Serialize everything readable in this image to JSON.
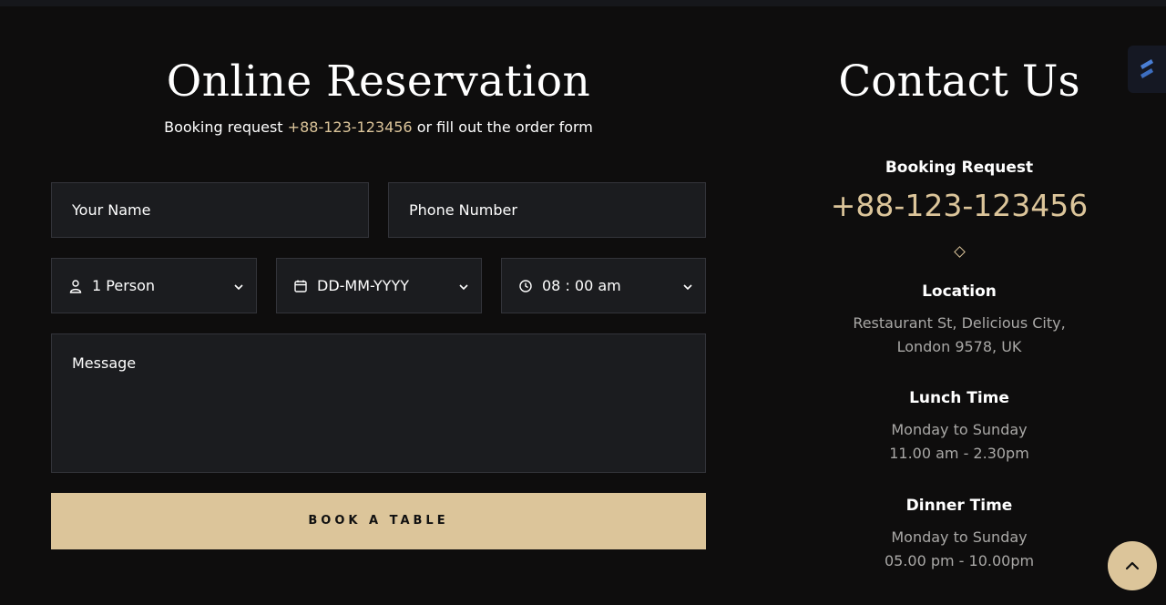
{
  "reservation": {
    "title": "Online Reservation",
    "subtitle_prefix": "Booking request ",
    "subtitle_phone": "+88-123-123456",
    "subtitle_suffix": " or fill out the order form",
    "name_placeholder": "Your Name",
    "phone_placeholder": "Phone Number",
    "persons_value": "1 Person",
    "date_value": "DD-MM-YYYY",
    "time_value": "08 : 00 am",
    "message_placeholder": "Message",
    "submit_label": "BOOK A TABLE"
  },
  "contact": {
    "title": "Contact Us",
    "booking_heading": "Booking Request",
    "booking_phone": "+88-123-123456",
    "location_heading": "Location",
    "location_line1": "Restaurant St, Delicious City,",
    "location_line2": "London 9578, UK",
    "lunch_heading": "Lunch Time",
    "lunch_days": "Monday to Sunday",
    "lunch_hours": "11.00 am - 2.30pm",
    "dinner_heading": "Dinner Time",
    "dinner_days": "Monday to Sunday",
    "dinner_hours": "05.00 pm - 10.00pm"
  },
  "colors": {
    "background": "#0e0d0d",
    "accent": "#dcc59a",
    "field_bg": "#1b1c1f",
    "muted_text": "#a9a8a6"
  },
  "icons": [
    "user-icon",
    "calendar-icon",
    "clock-icon",
    "chevron-down-icon",
    "chevron-up-icon",
    "logo-badge-icon",
    "diamond-divider-icon"
  ]
}
